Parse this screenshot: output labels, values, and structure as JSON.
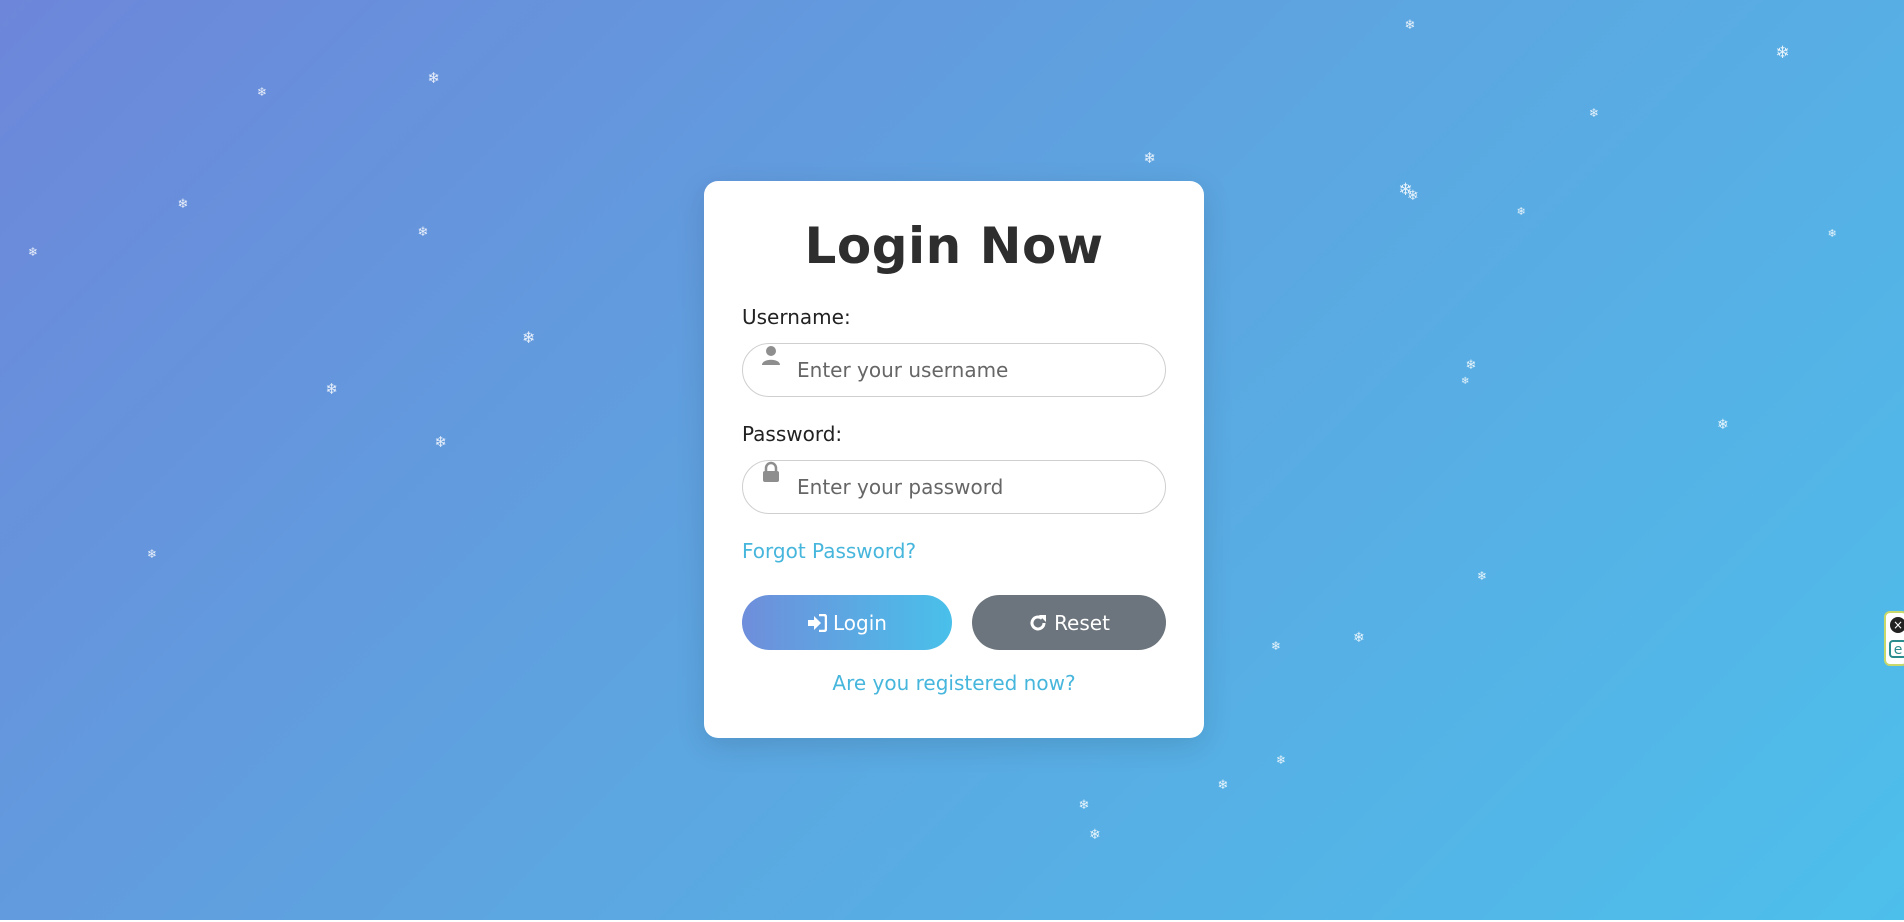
{
  "login": {
    "title": "Login Now",
    "username_label": "Username:",
    "username_placeholder": "Enter your username",
    "username_value": "",
    "password_label": "Password:",
    "password_placeholder": "Enter your password",
    "password_value": "",
    "forgot_link": "Forgot Password?",
    "login_button": "Login",
    "reset_button": "Reset",
    "register_link": "Are you registered now?"
  },
  "icons": {
    "username_field": "user-icon",
    "password_field": "lock-icon",
    "login_button": "sign-in-icon",
    "reset_button": "refresh-icon",
    "snowflake": "snowflake-icon"
  },
  "snowflake_glyph": "❄",
  "colors": {
    "gradient_start": "#6d86d9",
    "gradient_end": "#4dbfeb",
    "link": "#47b6dc",
    "reset_button": "#6c757d",
    "title": "#2e2e2e"
  }
}
